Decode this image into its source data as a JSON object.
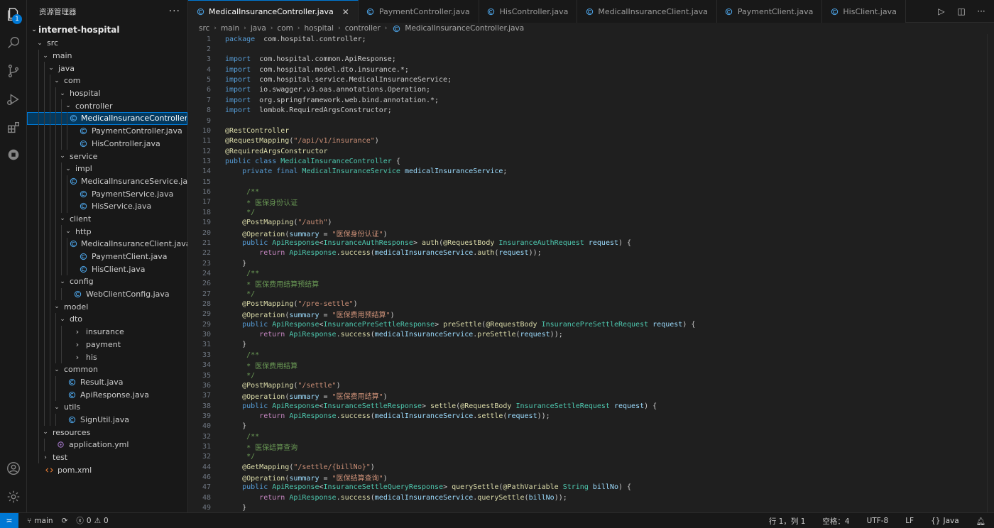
{
  "explorer": {
    "title": "资源管理器",
    "more": "···",
    "badge": "1",
    "root": "internet-hospital",
    "tree": [
      {
        "label": "src",
        "depth": 0,
        "kind": "folder",
        "open": true
      },
      {
        "label": "main",
        "depth": 1,
        "kind": "folder",
        "open": true
      },
      {
        "label": "java",
        "depth": 2,
        "kind": "folder",
        "open": true
      },
      {
        "label": "com",
        "depth": 3,
        "kind": "folder",
        "open": true
      },
      {
        "label": "hospital",
        "depth": 4,
        "kind": "folder",
        "open": true
      },
      {
        "label": "controller",
        "depth": 5,
        "kind": "folder",
        "open": true
      },
      {
        "label": "MedicalInsuranceController.java",
        "depth": 6,
        "kind": "java",
        "selected": true
      },
      {
        "label": "PaymentController.java",
        "depth": 6,
        "kind": "java"
      },
      {
        "label": "HisController.java",
        "depth": 6,
        "kind": "java"
      },
      {
        "label": "service",
        "depth": 4,
        "kind": "folder",
        "open": true
      },
      {
        "label": "impl",
        "depth": 5,
        "kind": "folder",
        "open": true
      },
      {
        "label": "MedicalInsuranceService.java",
        "depth": 6,
        "kind": "java"
      },
      {
        "label": "PaymentService.java",
        "depth": 6,
        "kind": "java"
      },
      {
        "label": "HisService.java",
        "depth": 6,
        "kind": "java"
      },
      {
        "label": "client",
        "depth": 4,
        "kind": "folder",
        "open": true
      },
      {
        "label": "http",
        "depth": 5,
        "kind": "folder",
        "open": true
      },
      {
        "label": "MedicalInsuranceClient.java",
        "depth": 6,
        "kind": "java"
      },
      {
        "label": "PaymentClient.java",
        "depth": 6,
        "kind": "java"
      },
      {
        "label": "HisClient.java",
        "depth": 6,
        "kind": "java"
      },
      {
        "label": "config",
        "depth": 4,
        "kind": "folder",
        "open": true
      },
      {
        "label": "WebClientConfig.java",
        "depth": 5,
        "kind": "java"
      },
      {
        "label": "model",
        "depth": 3,
        "kind": "folder",
        "open": true
      },
      {
        "label": "dto",
        "depth": 4,
        "kind": "folder",
        "open": true
      },
      {
        "label": "insurance",
        "depth": 5,
        "kind": "folder-closed"
      },
      {
        "label": "payment",
        "depth": 5,
        "kind": "folder-closed"
      },
      {
        "label": "his",
        "depth": 5,
        "kind": "folder-closed"
      },
      {
        "label": "common",
        "depth": 3,
        "kind": "folder",
        "open": true
      },
      {
        "label": "Result.java",
        "depth": 4,
        "kind": "java"
      },
      {
        "label": "ApiResponse.java",
        "depth": 4,
        "kind": "java"
      },
      {
        "label": "utils",
        "depth": 3,
        "kind": "folder",
        "open": true
      },
      {
        "label": "SignUtil.java",
        "depth": 4,
        "kind": "java"
      },
      {
        "label": "resources",
        "depth": 1,
        "kind": "folder",
        "open": true
      },
      {
        "label": "application.yml",
        "depth": 2,
        "kind": "yml"
      },
      {
        "label": "test",
        "depth": 1,
        "kind": "folder",
        "open": false
      },
      {
        "label": "pom.xml",
        "depth": 0,
        "kind": "xml"
      }
    ]
  },
  "tabs": [
    {
      "label": "MedicalInsuranceController.java",
      "active": true
    },
    {
      "label": "PaymentController.java"
    },
    {
      "label": "HisController.java"
    },
    {
      "label": "MedicalInsuranceClient.java"
    },
    {
      "label": "PaymentClient.java"
    },
    {
      "label": "HisClient.java"
    }
  ],
  "breadcrumb": [
    "src",
    "main",
    "java",
    "com",
    "hospital",
    "controller",
    "MedicalInsuranceController.java"
  ],
  "code_lines": [
    {
      "n": "1",
      "t": [
        [
          "kw",
          "package"
        ],
        [
          "",
          "  com.hospital.controller;"
        ]
      ]
    },
    {
      "n": "2",
      "t": []
    },
    {
      "n": "3",
      "t": [
        [
          "kw",
          "import"
        ],
        [
          "",
          "  com.hospital.common.ApiResponse;"
        ]
      ]
    },
    {
      "n": "4",
      "t": [
        [
          "kw",
          "import"
        ],
        [
          "",
          "  com.hospital.model.dto.insurance.*;"
        ]
      ]
    },
    {
      "n": "5",
      "t": [
        [
          "kw",
          "import"
        ],
        [
          "",
          "  com.hospital.service.MedicalInsuranceService;"
        ]
      ]
    },
    {
      "n": "6",
      "t": [
        [
          "kw",
          "import"
        ],
        [
          "",
          "  io.swagger.v3.oas.annotations.Operation;"
        ]
      ]
    },
    {
      "n": "7",
      "t": [
        [
          "kw",
          "import"
        ],
        [
          "",
          "  org.springframework.web.bind.annotation.*;"
        ]
      ]
    },
    {
      "n": "8",
      "t": [
        [
          "kw",
          "import"
        ],
        [
          "",
          "  lombok.RequiredArgsConstructor;"
        ]
      ]
    },
    {
      "n": "9",
      "t": []
    },
    {
      "n": "10",
      "t": [
        [
          "ann",
          "@RestController"
        ]
      ]
    },
    {
      "n": "11",
      "t": [
        [
          "ann",
          "@RequestMapping"
        ],
        [
          "",
          "("
        ],
        [
          "str",
          "\"/api/v1/insurance\""
        ],
        [
          "",
          ")"
        ]
      ]
    },
    {
      "n": "12",
      "t": [
        [
          "ann",
          "@RequiredArgsConstructor"
        ]
      ]
    },
    {
      "n": "13",
      "t": [
        [
          "kw",
          "public"
        ],
        [
          "",
          " "
        ],
        [
          "kw",
          "class"
        ],
        [
          "",
          " "
        ],
        [
          "typ",
          "MedicalInsuranceController"
        ],
        [
          "",
          " {"
        ]
      ]
    },
    {
      "n": "14",
      "t": [
        [
          "",
          "    "
        ],
        [
          "kw",
          "private"
        ],
        [
          "",
          " "
        ],
        [
          "kw",
          "final"
        ],
        [
          "",
          " "
        ],
        [
          "typ",
          "MedicalInsuranceService"
        ],
        [
          "",
          " "
        ],
        [
          "var",
          "medicalInsuranceService"
        ],
        [
          "",
          ";"
        ]
      ]
    },
    {
      "n": "15",
      "t": []
    },
    {
      "n": "16",
      "t": [
        [
          "cmt",
          "     /**"
        ]
      ]
    },
    {
      "n": "17",
      "t": [
        [
          "cmt",
          "     * 医保身份认证"
        ]
      ]
    },
    {
      "n": "18",
      "t": [
        [
          "cmt",
          "     */"
        ]
      ]
    },
    {
      "n": "19",
      "t": [
        [
          "",
          "    "
        ],
        [
          "ann",
          "@PostMapping"
        ],
        [
          "",
          "("
        ],
        [
          "str",
          "\"/auth\""
        ],
        [
          "",
          ")"
        ]
      ]
    },
    {
      "n": "20",
      "t": [
        [
          "",
          "    "
        ],
        [
          "ann",
          "@Operation"
        ],
        [
          "",
          "("
        ],
        [
          "var",
          "summary"
        ],
        [
          "",
          " = "
        ],
        [
          "str",
          "\"医保身份认证\""
        ],
        [
          "",
          ")"
        ]
      ]
    },
    {
      "n": "21",
      "t": [
        [
          "",
          "    "
        ],
        [
          "kw",
          "public"
        ],
        [
          "",
          " "
        ],
        [
          "typ",
          "ApiResponse"
        ],
        [
          "",
          "<"
        ],
        [
          "typ",
          "InsuranceAuthResponse"
        ],
        [
          "",
          "> "
        ],
        [
          "fn",
          "auth"
        ],
        [
          "",
          "("
        ],
        [
          "ann",
          "@RequestBody"
        ],
        [
          "",
          " "
        ],
        [
          "typ",
          "InsuranceAuthRequest"
        ],
        [
          "",
          " "
        ],
        [
          "var",
          "request"
        ],
        [
          "",
          ") {"
        ]
      ]
    },
    {
      "n": "22",
      "t": [
        [
          "",
          "        "
        ],
        [
          "ctl",
          "return"
        ],
        [
          "",
          " "
        ],
        [
          "typ",
          "ApiResponse"
        ],
        [
          "",
          "."
        ],
        [
          "fn",
          "success"
        ],
        [
          "",
          "("
        ],
        [
          "var",
          "medicalInsuranceService"
        ],
        [
          "",
          "."
        ],
        [
          "fn",
          "auth"
        ],
        [
          "",
          "("
        ],
        [
          "var",
          "request"
        ],
        [
          "",
          "));"
        ]
      ]
    },
    {
      "n": "23",
      "t": [
        [
          "",
          "    }"
        ]
      ]
    },
    {
      "n": "24",
      "t": [
        [
          "cmt",
          "     /**"
        ]
      ]
    },
    {
      "n": "26",
      "t": [
        [
          "cmt",
          "     * 医保费用结算预结算"
        ]
      ]
    },
    {
      "n": "27",
      "t": [
        [
          "cmt",
          "     */"
        ]
      ]
    },
    {
      "n": "28",
      "t": [
        [
          "",
          "    "
        ],
        [
          "ann",
          "@PostMapping"
        ],
        [
          "",
          "("
        ],
        [
          "str",
          "\"/pre-settle\""
        ],
        [
          "",
          ")"
        ]
      ]
    },
    {
      "n": "29",
      "t": [
        [
          "",
          "    "
        ],
        [
          "ann",
          "@Operation"
        ],
        [
          "",
          "("
        ],
        [
          "var",
          "summary"
        ],
        [
          "",
          " = "
        ],
        [
          "str",
          "\"医保费用预结算\""
        ],
        [
          "",
          ")"
        ]
      ]
    },
    {
      "n": "29",
      "t": [
        [
          "",
          "    "
        ],
        [
          "kw",
          "public"
        ],
        [
          "",
          " "
        ],
        [
          "typ",
          "ApiResponse"
        ],
        [
          "",
          "<"
        ],
        [
          "typ",
          "InsurancePreSettleResponse"
        ],
        [
          "",
          "> "
        ],
        [
          "fn",
          "preSettle"
        ],
        [
          "",
          "("
        ],
        [
          "ann",
          "@RequestBody"
        ],
        [
          "",
          " "
        ],
        [
          "typ",
          "InsurancePreSettleRequest"
        ],
        [
          "",
          " "
        ],
        [
          "var",
          "request"
        ],
        [
          "",
          ") {"
        ]
      ]
    },
    {
      "n": "30",
      "t": [
        [
          "",
          "        "
        ],
        [
          "ctl",
          "return"
        ],
        [
          "",
          " "
        ],
        [
          "typ",
          "ApiResponse"
        ],
        [
          "",
          "."
        ],
        [
          "fn",
          "success"
        ],
        [
          "",
          "("
        ],
        [
          "var",
          "medicalInsuranceService"
        ],
        [
          "",
          "."
        ],
        [
          "fn",
          "preSettle"
        ],
        [
          "",
          "("
        ],
        [
          "var",
          "request"
        ],
        [
          "",
          "));"
        ]
      ]
    },
    {
      "n": "31",
      "t": [
        [
          "",
          "    }"
        ]
      ]
    },
    {
      "n": "33",
      "t": [
        [
          "cmt",
          "     /**"
        ]
      ]
    },
    {
      "n": "34",
      "t": [
        [
          "cmt",
          "     * 医保费用结算"
        ]
      ]
    },
    {
      "n": "35",
      "t": [
        [
          "cmt",
          "     */"
        ]
      ]
    },
    {
      "n": "36",
      "t": [
        [
          "",
          "    "
        ],
        [
          "ann",
          "@PostMapping"
        ],
        [
          "",
          "("
        ],
        [
          "str",
          "\"/settle\""
        ],
        [
          "",
          ")"
        ]
      ]
    },
    {
      "n": "37",
      "t": [
        [
          "",
          "    "
        ],
        [
          "ann",
          "@Operation"
        ],
        [
          "",
          "("
        ],
        [
          "var",
          "summary"
        ],
        [
          "",
          " = "
        ],
        [
          "str",
          "\"医保费用结算\""
        ],
        [
          "",
          ")"
        ]
      ]
    },
    {
      "n": "38",
      "t": [
        [
          "",
          "    "
        ],
        [
          "kw",
          "public"
        ],
        [
          "",
          " "
        ],
        [
          "typ",
          "ApiResponse"
        ],
        [
          "",
          "<"
        ],
        [
          "typ",
          "InsuranceSettleResponse"
        ],
        [
          "",
          "> "
        ],
        [
          "fn",
          "settle"
        ],
        [
          "",
          "("
        ],
        [
          "ann",
          "@RequestBody"
        ],
        [
          "",
          " "
        ],
        [
          "typ",
          "InsuranceSettleRequest"
        ],
        [
          "",
          " "
        ],
        [
          "var",
          "request"
        ],
        [
          "",
          ") {"
        ]
      ]
    },
    {
      "n": "39",
      "t": [
        [
          "",
          "        "
        ],
        [
          "ctl",
          "return"
        ],
        [
          "",
          " "
        ],
        [
          "typ",
          "ApiResponse"
        ],
        [
          "",
          "."
        ],
        [
          "fn",
          "success"
        ],
        [
          "",
          "("
        ],
        [
          "var",
          "medicalInsuranceService"
        ],
        [
          "",
          "."
        ],
        [
          "fn",
          "settle"
        ],
        [
          "",
          "("
        ],
        [
          "var",
          "request"
        ],
        [
          "",
          "));"
        ]
      ]
    },
    {
      "n": "40",
      "t": [
        [
          "",
          "    }"
        ]
      ]
    },
    {
      "n": "32",
      "t": [
        [
          "cmt",
          "     /**"
        ]
      ]
    },
    {
      "n": "31",
      "t": [
        [
          "cmt",
          "     * 医保结算查询"
        ]
      ]
    },
    {
      "n": "32",
      "t": [
        [
          "cmt",
          "     */"
        ]
      ]
    },
    {
      "n": "44",
      "t": [
        [
          "",
          "    "
        ],
        [
          "ann",
          "@GetMapping"
        ],
        [
          "",
          "("
        ],
        [
          "str",
          "\"/settle/{billNo}\""
        ],
        [
          "",
          ")"
        ]
      ]
    },
    {
      "n": "46",
      "t": [
        [
          "",
          "    "
        ],
        [
          "ann",
          "@Operation"
        ],
        [
          "",
          "("
        ],
        [
          "var",
          "summary"
        ],
        [
          "",
          " = "
        ],
        [
          "str",
          "\"医保结算查询\""
        ],
        [
          "",
          ")"
        ]
      ]
    },
    {
      "n": "47",
      "t": [
        [
          "",
          "    "
        ],
        [
          "kw",
          "public"
        ],
        [
          "",
          " "
        ],
        [
          "typ",
          "ApiResponse"
        ],
        [
          "",
          "<"
        ],
        [
          "typ",
          "InsuranceSettleQueryResponse"
        ],
        [
          "",
          "> "
        ],
        [
          "fn",
          "querySettle"
        ],
        [
          "",
          "("
        ],
        [
          "ann",
          "@PathVariable"
        ],
        [
          "",
          " "
        ],
        [
          "typ",
          "String"
        ],
        [
          "",
          " "
        ],
        [
          "var",
          "billNo"
        ],
        [
          "",
          ") {"
        ]
      ]
    },
    {
      "n": "48",
      "t": [
        [
          "",
          "        "
        ],
        [
          "ctl",
          "return"
        ],
        [
          "",
          " "
        ],
        [
          "typ",
          "ApiResponse"
        ],
        [
          "",
          "."
        ],
        [
          "fn",
          "success"
        ],
        [
          "",
          "("
        ],
        [
          "var",
          "medicalInsuranceService"
        ],
        [
          "",
          "."
        ],
        [
          "fn",
          "querySettle"
        ],
        [
          "",
          "("
        ],
        [
          "var",
          "billNo"
        ],
        [
          "",
          "));"
        ]
      ]
    },
    {
      "n": "49",
      "t": [
        [
          "",
          "    }"
        ]
      ]
    },
    {
      "n": "40",
      "t": [
        [
          "",
          "}"
        ]
      ]
    }
  ],
  "status": {
    "branch": "main",
    "errors": "0",
    "warnings": "0",
    "position": "行 1，列 1",
    "spaces": "空格：4",
    "encoding": "UTF-8",
    "eol": "LF",
    "language": "Java",
    "lang_braces": "{}"
  }
}
